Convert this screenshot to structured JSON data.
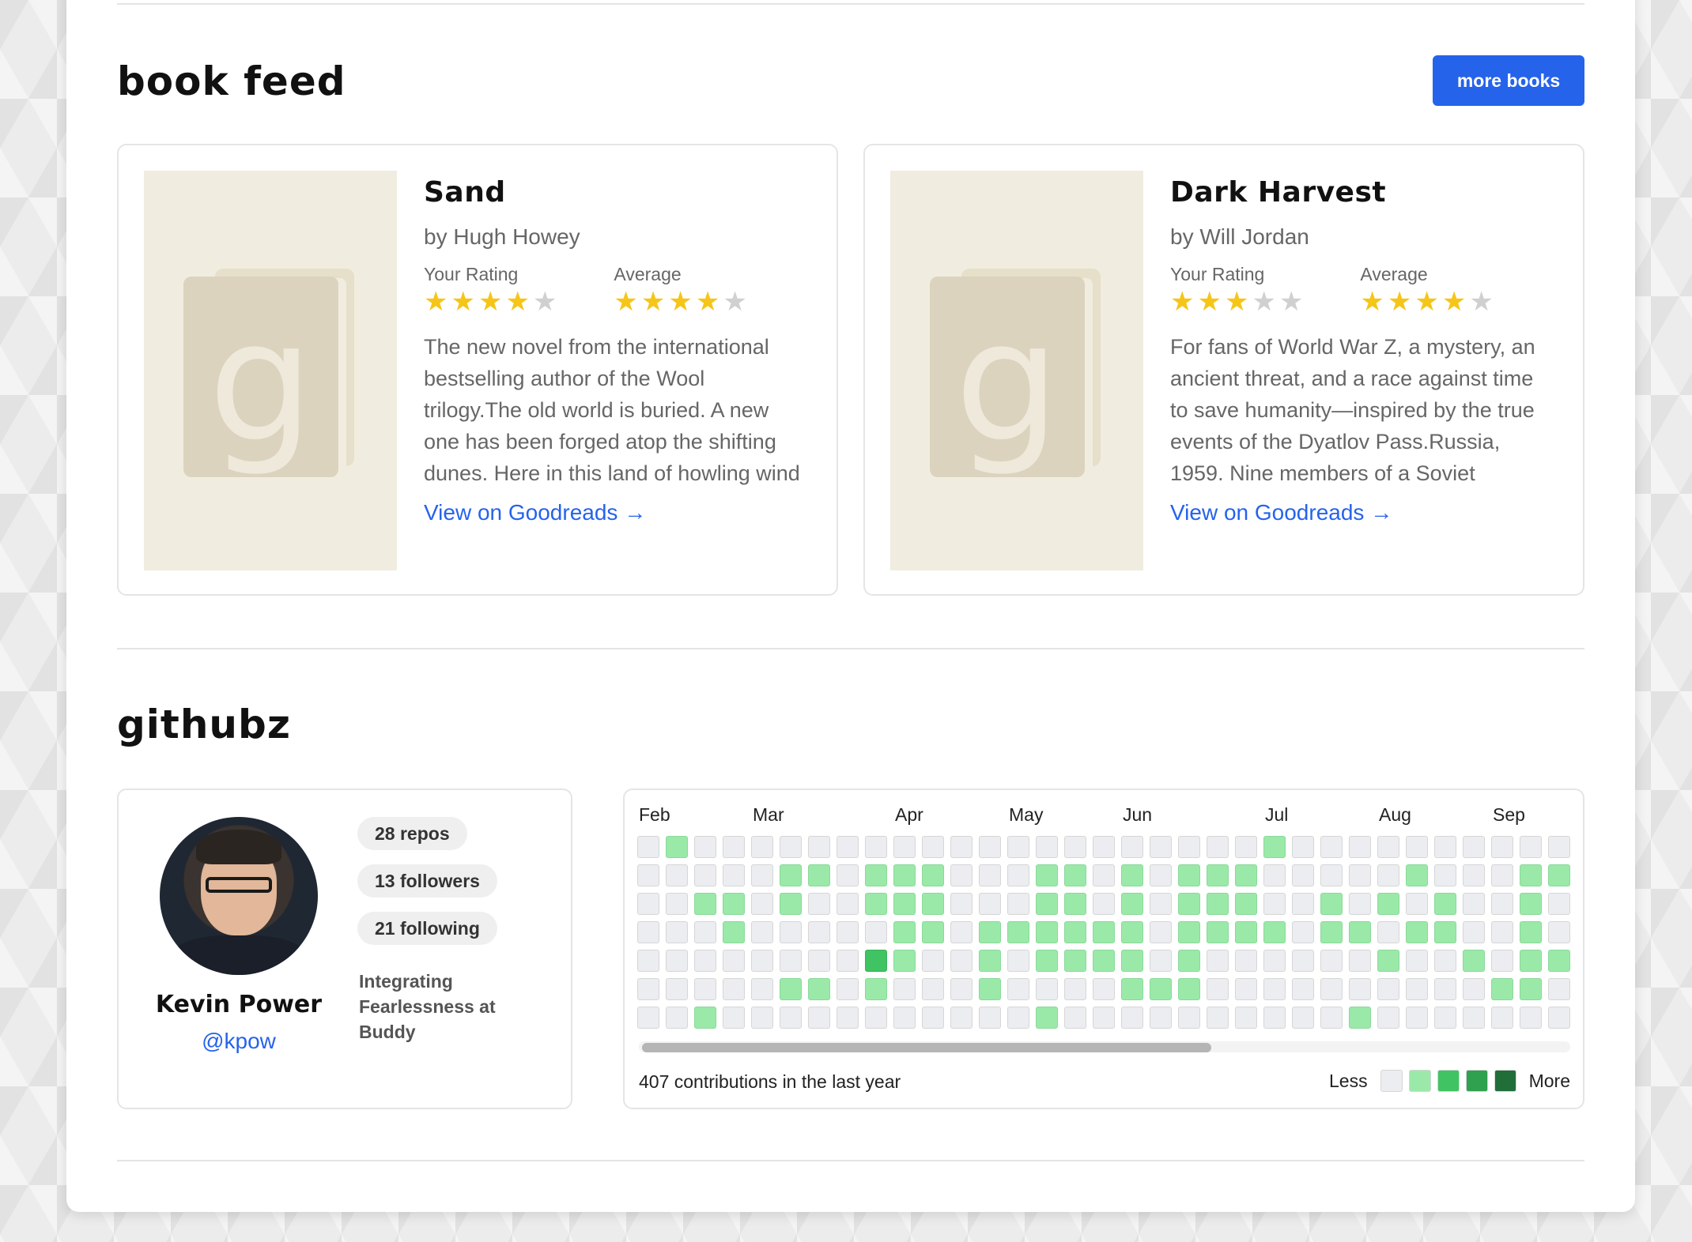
{
  "book_feed": {
    "heading": "book feed",
    "more_button": "more books",
    "rating_label": "Your Rating",
    "average_label": "Average",
    "books": [
      {
        "title": "Sand",
        "author": "by Hugh Howey",
        "your_rating": 4,
        "average_rating": 4,
        "description": "The new novel from the international bestselling author of the Wool trilogy.The old world is buried. A new one has been forged atop the shifting dunes. Here in this land of howling wind and infernal sand, four siblings…",
        "link": "View on Goodreads →",
        "cover_icon": "goodreads-placeholder-icon"
      },
      {
        "title": "Dark Harvest",
        "author": "by Will Jordan",
        "your_rating": 3,
        "average_rating": 4,
        "description": "For fans of World War Z, a mystery, an ancient threat, and a race against time to save humanity—inspired by the true events of the Dyatlov Pass.Russia, 1959. Nine members of a Soviet mountaineering team on an ambitious…",
        "link": "View on Goodreads →",
        "cover_icon": "goodreads-placeholder-icon"
      }
    ]
  },
  "githubz": {
    "heading": "githubz",
    "profile": {
      "name": "Kevin Power",
      "handle": "@kpow",
      "repos": "28 repos",
      "followers": "13 followers",
      "following": "21 following",
      "bio": "Integrating Fearlessness at Buddy"
    },
    "contributions": {
      "months": [
        "Feb",
        "Mar",
        "Apr",
        "May",
        "Jun",
        "Jul",
        "Aug",
        "Sep"
      ],
      "month_week_index": [
        0,
        4,
        9,
        13,
        17,
        22,
        26,
        30
      ],
      "total": "407 contributions in the last year",
      "less_label": "Less",
      "more_label": "More",
      "colors": [
        "#ebedf0",
        "#9be9a8",
        "#40c463",
        "#30a14e",
        "#216e39"
      ],
      "weeks": [
        [
          0,
          0,
          0,
          0,
          0,
          0,
          0
        ],
        [
          1,
          0,
          0,
          0,
          0,
          0,
          0
        ],
        [
          0,
          0,
          1,
          0,
          0,
          0,
          1
        ],
        [
          0,
          0,
          1,
          1,
          0,
          0,
          0
        ],
        [
          0,
          0,
          0,
          0,
          0,
          0,
          0
        ],
        [
          0,
          1,
          1,
          0,
          0,
          1,
          0
        ],
        [
          0,
          1,
          0,
          0,
          0,
          1,
          0
        ],
        [
          0,
          0,
          0,
          0,
          0,
          0,
          0
        ],
        [
          0,
          1,
          1,
          0,
          2,
          1,
          0
        ],
        [
          0,
          1,
          1,
          1,
          1,
          0,
          0
        ],
        [
          0,
          1,
          1,
          1,
          0,
          0,
          0
        ],
        [
          0,
          0,
          0,
          0,
          0,
          0,
          0
        ],
        [
          0,
          0,
          0,
          1,
          1,
          1,
          0
        ],
        [
          0,
          0,
          0,
          1,
          0,
          0,
          0
        ],
        [
          0,
          1,
          1,
          1,
          1,
          0,
          1
        ],
        [
          0,
          1,
          1,
          1,
          1,
          0,
          0
        ],
        [
          0,
          0,
          0,
          1,
          1,
          0,
          0
        ],
        [
          0,
          1,
          1,
          1,
          1,
          1,
          0
        ],
        [
          0,
          0,
          0,
          0,
          0,
          1,
          0
        ],
        [
          0,
          1,
          1,
          1,
          1,
          1,
          0
        ],
        [
          0,
          1,
          1,
          1,
          0,
          0,
          0
        ],
        [
          0,
          1,
          1,
          1,
          0,
          0,
          0
        ],
        [
          1,
          0,
          0,
          1,
          0,
          0,
          0
        ],
        [
          0,
          0,
          0,
          0,
          0,
          0,
          0
        ],
        [
          0,
          0,
          1,
          1,
          0,
          0,
          0
        ],
        [
          0,
          0,
          0,
          1,
          0,
          0,
          1
        ],
        [
          0,
          0,
          1,
          0,
          1,
          0,
          0
        ],
        [
          0,
          1,
          0,
          1,
          0,
          0,
          0
        ],
        [
          0,
          0,
          1,
          1,
          0,
          0,
          0
        ],
        [
          0,
          0,
          0,
          0,
          1,
          0,
          0
        ],
        [
          0,
          0,
          0,
          0,
          0,
          1,
          0
        ],
        [
          0,
          1,
          1,
          1,
          1,
          1,
          0
        ],
        [
          0,
          1,
          0,
          0,
          1,
          0,
          0
        ]
      ]
    }
  }
}
